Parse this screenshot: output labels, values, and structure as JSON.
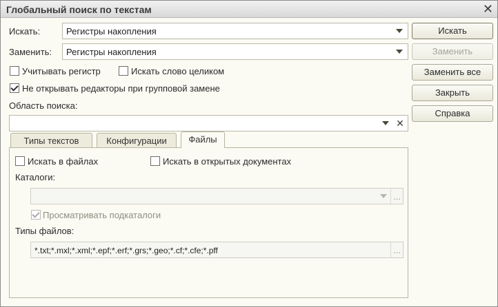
{
  "window": {
    "title": "Глобальный поиск по текстам"
  },
  "search": {
    "label": "Искать:",
    "value": "Регистры накопления"
  },
  "replace": {
    "label": "Заменить:",
    "value": "Регистры накопления"
  },
  "options": {
    "case_label": "Учитывать регистр",
    "case_checked": false,
    "whole_word_label": "Искать слово целиком",
    "whole_word_checked": false,
    "no_editors_label": "Не открывать редакторы при групповой замене",
    "no_editors_checked": true
  },
  "scope": {
    "label": "Область поиска:",
    "value": ""
  },
  "buttons": {
    "search": "Искать",
    "replace": "Заменить",
    "replace_all": "Заменить все",
    "close": "Закрыть",
    "help": "Справка"
  },
  "tabs": [
    {
      "label": "Типы текстов",
      "active": false
    },
    {
      "label": "Конфигурации",
      "active": false
    },
    {
      "label": "Файлы",
      "active": true
    }
  ],
  "files_tab": {
    "search_in_files_label": "Искать в файлах",
    "search_in_files_checked": false,
    "search_in_open_docs_label": "Искать в открытых документах",
    "search_in_open_docs_checked": false,
    "catalogs_label": "Каталоги:",
    "catalogs_value": "",
    "browse_subdirs_label": "Просматривать подкаталоги",
    "browse_subdirs_checked": true,
    "file_types_label": "Типы файлов:",
    "file_types_value": "*.txt;*.mxl;*.xml;*.epf;*.erf;*.grs;*.geo;*.cf;*.cfe;*.pff",
    "ellipsis": "..."
  }
}
